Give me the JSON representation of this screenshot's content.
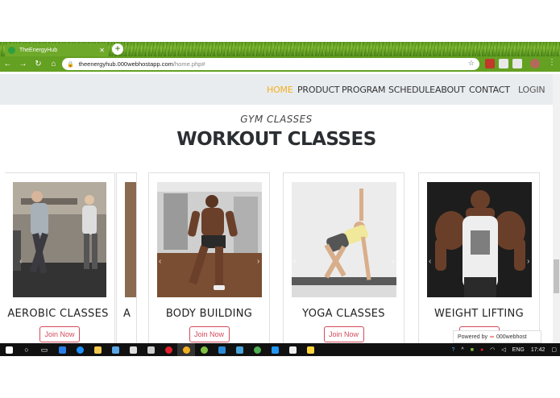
{
  "browser": {
    "tab_title": "TheEnergyHub",
    "tab_close": "✕",
    "new_tab": "+",
    "url_host": "theenergyhub.000webhostapp.com",
    "url_path": "/home.php#",
    "back": "←",
    "forward": "→",
    "reload": "↻",
    "home": "⌂",
    "star": "☆",
    "lock": "🔒",
    "menu": "⋮"
  },
  "nav": {
    "items": [
      "HOME",
      "PRODUCT",
      "PROGRAM",
      "SCHEDULE",
      "ABOUT",
      "CONTACT"
    ],
    "login": "LOGIN",
    "active_color": "#f2b01e"
  },
  "section": {
    "subtitle": "GYM CLASSES",
    "title": "WORKOUT CLASSES"
  },
  "cards": [
    {
      "name": "AEROBIC CLASSES",
      "button": "Join Now"
    },
    {
      "name": "A",
      "button": ""
    },
    {
      "name": "BODY BUILDING",
      "button": "Join Now"
    },
    {
      "name": "YOGA CLASSES",
      "button": "Join Now"
    },
    {
      "name": "WEIGHT LIFTING",
      "button": "Join Now"
    }
  ],
  "badge": {
    "prefix": "Powered by",
    "logo": "∞",
    "brand": "000webhost"
  },
  "taskbar": {
    "lang": "ENG",
    "time": "17:42"
  },
  "colors": {
    "chrome_green": "#64a022",
    "nav_bg": "#e9ecef",
    "button_accent": "#d44a5a"
  }
}
